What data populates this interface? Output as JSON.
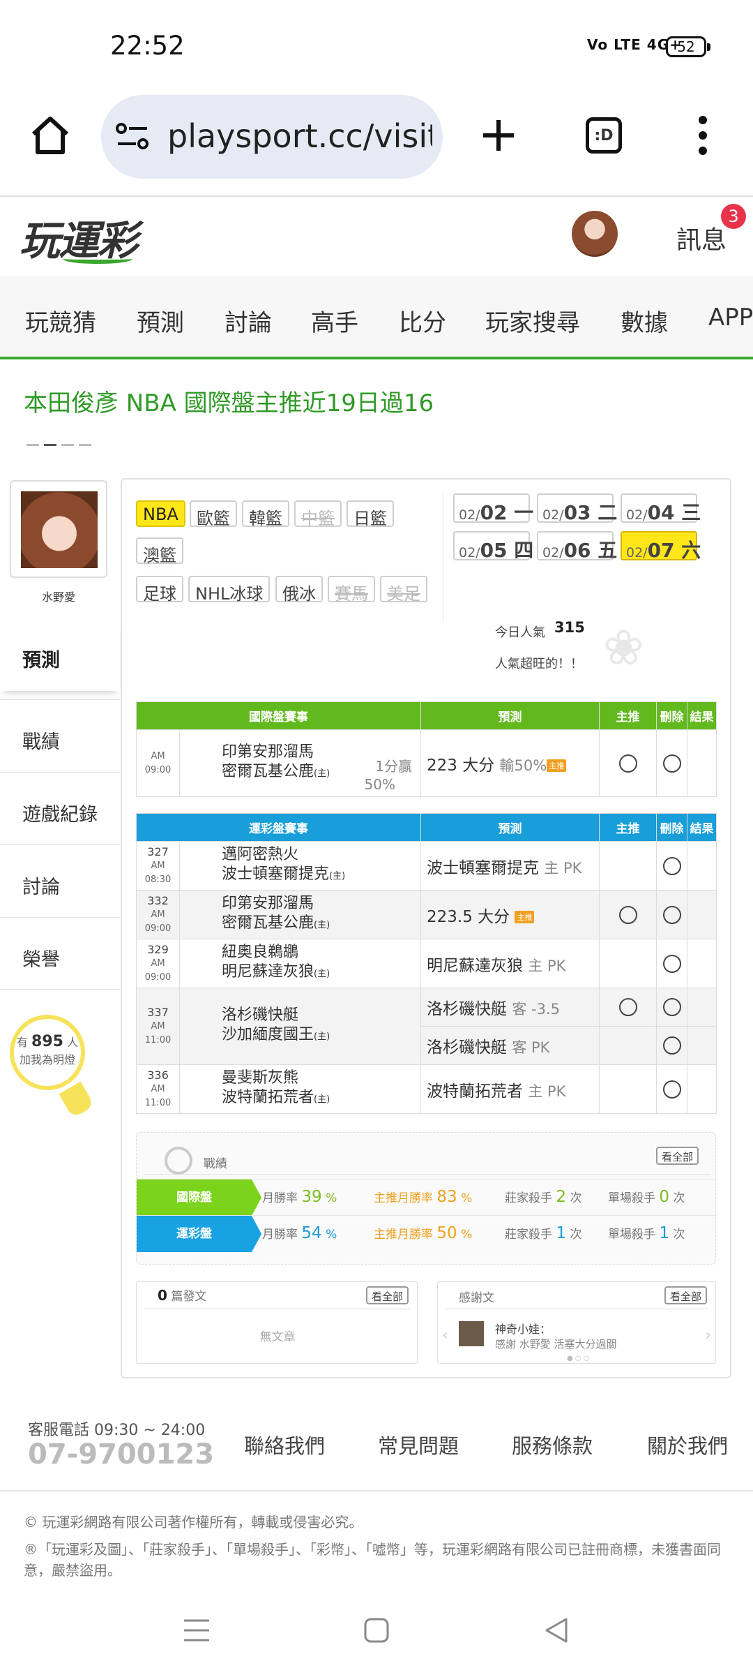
{
  "status": {
    "time": "22:52",
    "network": "Vo LTE 4G+",
    "battery": "52"
  },
  "browser": {
    "url": "playsport.cc/visit",
    "tabs": ":D"
  },
  "site": {
    "logo": "玩運彩",
    "messages_label": "訊息",
    "messages_badge": "3"
  },
  "nav": [
    "玩競猜",
    "預測",
    "討論",
    "高手",
    "比分",
    "玩家搜尋",
    "數據",
    "APP"
  ],
  "headline": "本田俊彥 NBA 國際盤主推近19日過16",
  "sidebar": {
    "name": "水野愛",
    "items": [
      "預測",
      "戰績",
      "遊戲紀錄",
      "討論",
      "榮譽"
    ],
    "bulb_prefix": "有",
    "bulb_count": "895",
    "bulb_suffix": "人",
    "bulb_text": "加我為明燈"
  },
  "leagues": [
    {
      "label": "NBA",
      "state": "selected"
    },
    {
      "label": "歐籃",
      "state": "normal"
    },
    {
      "label": "韓籃",
      "state": "normal"
    },
    {
      "label": "中籃",
      "state": "disabled"
    },
    {
      "label": "日籃",
      "state": "normal"
    },
    {
      "label": "澳籃",
      "state": "normal"
    },
    {
      "label": "足球",
      "state": "normal"
    },
    {
      "label": "NHL冰球",
      "state": "normal"
    },
    {
      "label": "俄冰",
      "state": "normal"
    },
    {
      "label": "賽馬",
      "state": "disabled"
    },
    {
      "label": "美足",
      "state": "disabled"
    }
  ],
  "dates": [
    {
      "md": "02/",
      "d": "02",
      "w": "一"
    },
    {
      "md": "02/",
      "d": "03",
      "w": "二"
    },
    {
      "md": "02/",
      "d": "04",
      "w": "三"
    },
    {
      "md": "02/",
      "d": "05",
      "w": "四"
    },
    {
      "md": "02/",
      "d": "06",
      "w": "五"
    },
    {
      "md": "02/",
      "d": "07",
      "w": "六",
      "selected": true
    }
  ],
  "popularity": {
    "label": "今日人氣",
    "value": "315",
    "text": "人氣超旺的！！"
  },
  "intl_table": {
    "headers": [
      "國際盤賽事",
      "預測",
      "主推",
      "刪除",
      "結果"
    ],
    "rows": [
      {
        "time": "AM 09:00",
        "away": "印第安那溜馬",
        "home": "密爾瓦基公鹿",
        "home_mark": "(主)",
        "line": "1分贏",
        "pct": "50%",
        "pred": "223 大分",
        "pred_note": "輸50%",
        "tag": "主推"
      }
    ]
  },
  "lottery_table": {
    "headers": [
      "運彩盤賽事",
      "預測",
      "主推",
      "刪除",
      "結果"
    ],
    "rows": [
      {
        "no": "327",
        "time": "AM 08:30",
        "away": "邁阿密熱火",
        "home": "波士頓塞爾提克",
        "home_mark": "(主)",
        "pred": "波士頓塞爾提克",
        "pred_note": "主 PK"
      },
      {
        "no": "332",
        "time": "AM 09:00",
        "away": "印第安那溜馬",
        "home": "密爾瓦基公鹿",
        "home_mark": "(主)",
        "pred": "223.5 大分",
        "tag": "主推"
      },
      {
        "no": "329",
        "time": "AM 09:00",
        "away": "紐奧良鵜鶘",
        "home": "明尼蘇達灰狼",
        "home_mark": "(主)",
        "pred": "明尼蘇達灰狼",
        "pred_note": "主 PK"
      },
      {
        "no": "337",
        "time": "AM 11:00",
        "away": "洛杉磯快艇",
        "home": "沙加緬度國王",
        "home_mark": "(主)",
        "pred": "洛杉磯快艇",
        "pred_note": "客 -3.5",
        "pred2": "洛杉磯快艇",
        "pred2_note": "客 PK"
      },
      {
        "no": "336",
        "time": "AM 11:00",
        "away": "曼斐斯灰熊",
        "home": "波特蘭拓荒者",
        "home_mark": "(主)",
        "pred": "波特蘭拓荒者",
        "pred_note": "主 PK"
      }
    ]
  },
  "record": {
    "title": "戰績",
    "view_all": "看全部",
    "rows": [
      {
        "label": "國際盤",
        "win_label": "月勝率",
        "win": "39",
        "main_label": "主推月勝率",
        "main": "83",
        "killer_label": "莊家殺手",
        "killer": "2",
        "single_label": "單場殺手",
        "single": "0",
        "pct": "%",
        "unit": "次"
      },
      {
        "label": "運彩盤",
        "win_label": "月勝率",
        "win": "54",
        "main_label": "主推月勝率",
        "main": "50",
        "killer_label": "莊家殺手",
        "killer": "1",
        "single_label": "單場殺手",
        "single": "1",
        "pct": "%",
        "unit": "次"
      }
    ]
  },
  "posts": {
    "count": "0",
    "label": "篇發文",
    "view_all": "看全部",
    "empty": "無文章"
  },
  "thanks": {
    "title": "感謝文",
    "view_all": "看全部",
    "user": "神奇小娃：",
    "text": "感謝 水野愛 活塞大分過關"
  },
  "footer": {
    "service_label": "客服電話 09:30 ~ 24:00",
    "tel": "07-9700123",
    "links": [
      "聯絡我們",
      "常見問題",
      "服務條款",
      "關於我們"
    ],
    "copy1": "© 玩運彩網路有限公司著作權所有，轉載或侵害必究。",
    "copy2": "®「玩運彩及圖」、「莊家殺手」、「單場殺手」、「彩幣」、「噓幣」等，玩運彩網路有限公司已註冊商標，未獲書面同意，嚴禁盜用。"
  },
  "colors": {
    "green": "#3aa82d",
    "intl_header": "#62b91e",
    "lottery_header": "#189ed9",
    "highlight": "#ffe619",
    "badge": "#e8334a"
  }
}
